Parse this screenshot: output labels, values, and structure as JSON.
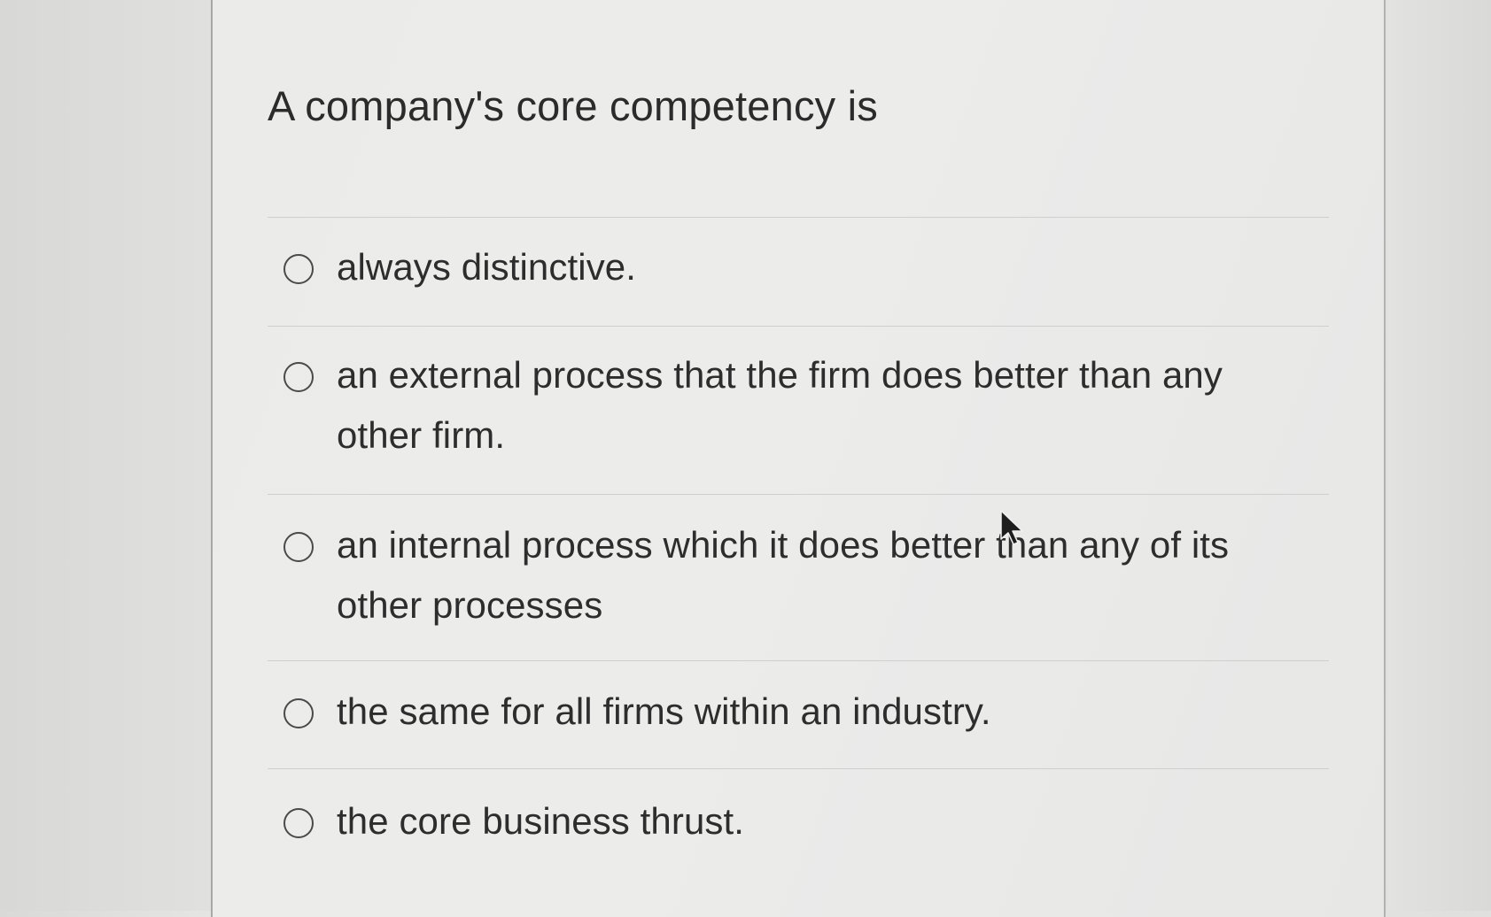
{
  "question": {
    "title": "A company's core competency is"
  },
  "options": [
    {
      "label": "always distinctive.",
      "selected": false
    },
    {
      "label": "an external process that the firm does better than any other firm.",
      "selected": false
    },
    {
      "label": "an internal process which it does better than any of its other processes",
      "selected": false
    },
    {
      "label": "the same for all firms within an industry.",
      "selected": false
    },
    {
      "label": "the core business thrust.",
      "selected": false
    }
  ],
  "icons": {
    "radio": "radio-unchecked-icon",
    "cursor": "mouse-pointer-icon"
  },
  "colors": {
    "text": "#2d2d2d",
    "divider": "#cfcfcd",
    "background": "#ebebea"
  }
}
